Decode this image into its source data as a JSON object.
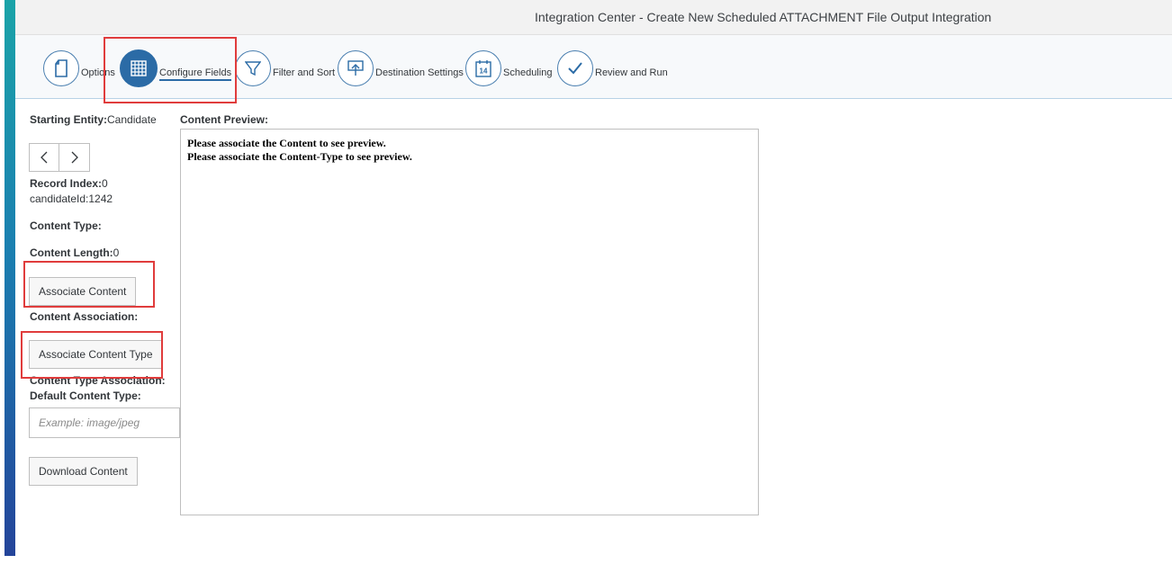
{
  "window": {
    "title": "Integration Center - Create New Scheduled ATTACHMENT File Output Integration"
  },
  "wizard": {
    "steps": [
      {
        "label": "Options",
        "icon": "document-icon",
        "active": false
      },
      {
        "label": "Configure Fields",
        "icon": "grid-icon",
        "active": true
      },
      {
        "label": "Filter and Sort",
        "icon": "filter-icon",
        "active": false
      },
      {
        "label": "Destination Settings",
        "icon": "upload-icon",
        "active": false
      },
      {
        "label": "Scheduling",
        "icon": "calendar-icon",
        "active": false,
        "calendar_day": "14"
      },
      {
        "label": "Review and Run",
        "icon": "checkmark-icon",
        "active": false
      }
    ]
  },
  "left": {
    "starting_entity_label": "Starting Entity:",
    "starting_entity_value": "Candidate",
    "record_index_label": "Record Index:",
    "record_index_value": "0",
    "candidate_id": "candidateId:1242",
    "content_type_label": "Content Type:",
    "content_length_label": "Content Length:",
    "content_length_value": "0",
    "associate_content_button": "Associate Content",
    "content_association_label": "Content Association:",
    "associate_content_type_button": "Associate Content Type",
    "content_type_association_label": "Content Type Association:",
    "default_content_type_label": "Default Content Type:",
    "default_content_type_placeholder": "Example: image/jpeg",
    "default_content_type_value": "",
    "download_content_button": "Download Content"
  },
  "preview": {
    "label": "Content Preview:",
    "lines": [
      "Please associate the Content to see preview.",
      "Please associate the Content-Type to see preview."
    ]
  },
  "colors": {
    "accent": "#2b6ba6",
    "highlight": "#e03c3c",
    "sidebar": "#1aa3a8"
  }
}
